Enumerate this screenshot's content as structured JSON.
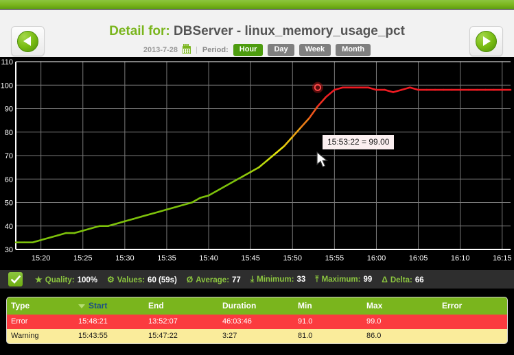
{
  "header": {
    "title_label": "Detail for:",
    "title_value": "DBServer - linux_memory_usage_pct",
    "date": "2013-7-28",
    "calendar_icon": "calendar-icon",
    "separator": "|",
    "period_label": "Period:",
    "periods": [
      {
        "label": "Hour",
        "active": true
      },
      {
        "label": "Day",
        "active": false
      },
      {
        "label": "Week",
        "active": false
      },
      {
        "label": "Month",
        "active": false
      }
    ],
    "prev_button": {
      "icon": "chevron-left-icon",
      "label": ""
    },
    "next_button": {
      "icon": "chevron-right-icon",
      "label": ""
    }
  },
  "chart_data": {
    "type": "line",
    "title": "",
    "xlabel": "",
    "ylabel": "",
    "ylim": [
      30,
      110
    ],
    "grid": true,
    "legend_position": "none",
    "background": "#000000",
    "gridline_color": "#7a7a7a",
    "colors": {
      "low": "#7dc10b",
      "mid": "#e8e80c",
      "high": "#ee1b22"
    },
    "ytick_labels": [
      "110",
      "100",
      "90",
      "80",
      "70",
      "60",
      "50",
      "40",
      "30"
    ],
    "ytick_values": [
      110,
      100,
      90,
      80,
      70,
      60,
      50,
      40,
      30
    ],
    "xtick_labels": [
      "15:20",
      "15:25",
      "15:30",
      "15:35",
      "15:40",
      "15:45",
      "15:50",
      "15:55",
      "16:00",
      "16:05",
      "16:10",
      "16:15"
    ],
    "xlim": [
      "15:17",
      "16:16"
    ],
    "series": [
      {
        "name": "linux_memory_usage_pct",
        "x": [
          "15:17",
          "15:18",
          "15:19",
          "15:20",
          "15:21",
          "15:22",
          "15:23",
          "15:24",
          "15:25",
          "15:26",
          "15:27",
          "15:28",
          "15:29",
          "15:30",
          "15:31",
          "15:32",
          "15:33",
          "15:34",
          "15:35",
          "15:36",
          "15:37",
          "15:38",
          "15:39",
          "15:40",
          "15:41",
          "15:42",
          "15:43",
          "15:44",
          "15:45",
          "15:46",
          "15:47",
          "15:48",
          "15:49",
          "15:50",
          "15:51",
          "15:52",
          "15:53",
          "15:54",
          "15:55",
          "15:56",
          "15:57",
          "15:58",
          "15:59",
          "16:00",
          "16:01",
          "16:02",
          "16:03",
          "16:04",
          "16:05",
          "16:06",
          "16:07",
          "16:08",
          "16:09",
          "16:10",
          "16:11",
          "16:12",
          "16:13",
          "16:14",
          "16:15",
          "16:16"
        ],
        "values": [
          33,
          33,
          33,
          34,
          35,
          36,
          37,
          37,
          38,
          39,
          40,
          40,
          41,
          42,
          43,
          44,
          45,
          46,
          47,
          48,
          49,
          50,
          52,
          53,
          55,
          57,
          59,
          61,
          63,
          65,
          68,
          71,
          74,
          78,
          82,
          86,
          91,
          95,
          98,
          99,
          99,
          99,
          99,
          98,
          98,
          97,
          98,
          99,
          98,
          98,
          98,
          98,
          98,
          98,
          98,
          98,
          98,
          98,
          98,
          98
        ]
      }
    ],
    "annotation": {
      "text": "15:53:22 = 99.00",
      "point_value": 99.0,
      "point_time": "15:53:22"
    }
  },
  "status": {
    "ok_icon": "check-icon",
    "items": [
      {
        "icon": "star-icon",
        "icon_glyph": "★",
        "label": "Quality:",
        "value": "100%"
      },
      {
        "icon": "gear-icon",
        "icon_glyph": "⚙",
        "label": "Values:",
        "value": "60 (59s)"
      },
      {
        "icon": "average-icon",
        "icon_glyph": "Ø",
        "label": "Average:",
        "value": "77"
      },
      {
        "icon": "minimum-icon",
        "icon_glyph": "⤓",
        "label": "Minimum:",
        "value": "33"
      },
      {
        "icon": "maximum-icon",
        "icon_glyph": "⤒",
        "label": "Maximum:",
        "value": "99"
      },
      {
        "icon": "delta-icon",
        "icon_glyph": "Δ",
        "label": "Delta:",
        "value": "66"
      }
    ]
  },
  "table": {
    "columns": [
      {
        "label": "Type",
        "sorted": false
      },
      {
        "label": "Start",
        "sorted": true
      },
      {
        "label": "End",
        "sorted": false
      },
      {
        "label": "Duration",
        "sorted": false
      },
      {
        "label": "Min",
        "sorted": false
      },
      {
        "label": "Max",
        "sorted": false
      },
      {
        "label": "Error",
        "sorted": false
      }
    ],
    "rows": [
      {
        "type": "Error",
        "start": "15:48:21",
        "end": "13:52:07",
        "duration": "46:03:46",
        "min": "91.0",
        "max": "99.0",
        "error": "",
        "severity": "error"
      },
      {
        "type": "Warning",
        "start": "15:43:55",
        "end": "15:47:22",
        "duration": "3:27",
        "min": "81.0",
        "max": "86.0",
        "error": "",
        "severity": "warning"
      }
    ]
  },
  "colors": {
    "brand_green": "#7ab51d",
    "error_red": "#fb3b3f",
    "warning_yellow": "#faec9b",
    "sorted_blue": "#1c4f86"
  }
}
